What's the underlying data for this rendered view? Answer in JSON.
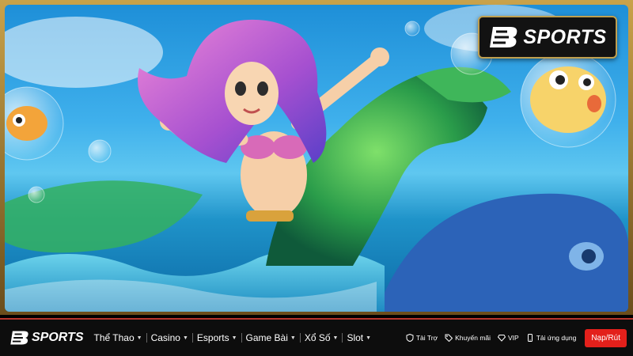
{
  "brand": {
    "name": "SPORTS",
    "accent": "#e3201b",
    "gold": "#c9a24a"
  },
  "banner": {
    "alt": "mermaid-promo-illustration"
  },
  "nav": {
    "menu": [
      {
        "label": "Thể Thao"
      },
      {
        "label": "Casino"
      },
      {
        "label": "Esports"
      },
      {
        "label": "Game Bài"
      },
      {
        "label": "Xổ Số"
      },
      {
        "label": "Slot"
      }
    ],
    "links": {
      "sponsor": "Tài Trợ",
      "promo": "Khuyến mãi",
      "vip": "VIP",
      "app": "Tải ứng dụng"
    },
    "cta": "Nạp/Rút"
  },
  "icons": {
    "sponsor": "shield-heart-icon",
    "promo": "tag-icon",
    "vip": "diamond-icon",
    "app": "phone-icon",
    "caret": "caret-down-icon"
  }
}
